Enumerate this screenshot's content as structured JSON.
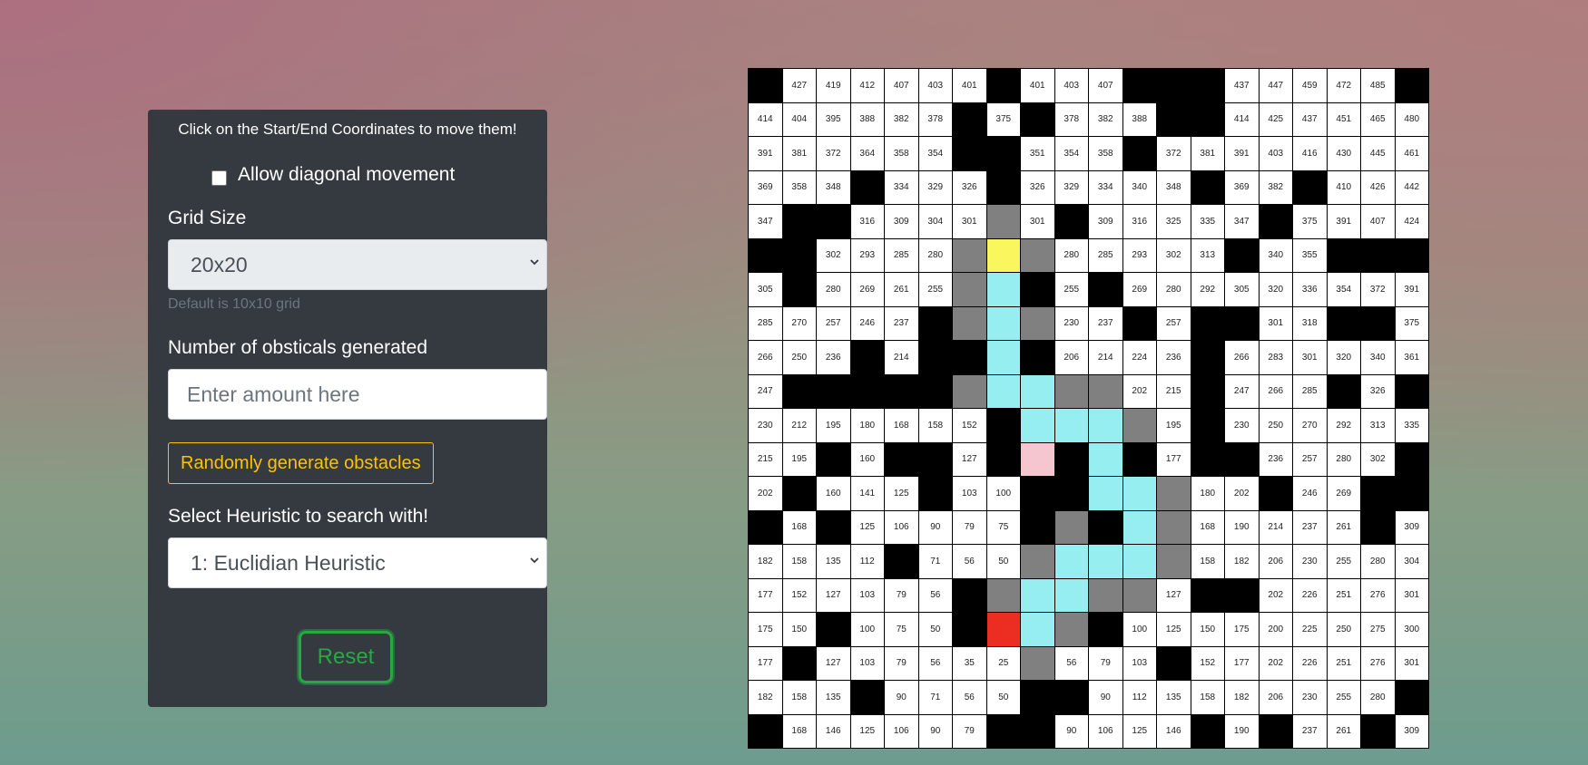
{
  "panel": {
    "hint": "Click on the Start/End Coordinates to move them!",
    "diagonal_label": "Allow diagonal movement",
    "grid_size_label": "Grid Size",
    "grid_size_value": "20x20",
    "grid_size_help": "Default is 10x10 grid",
    "obstacles_label": "Number of obsticals generated",
    "obstacles_placeholder": "Enter amount here",
    "generate_button": "Randomly generate obstacles",
    "heuristic_label": "Select Heuristic to search with!",
    "heuristic_value": "1: Euclidian Heuristic",
    "reset_button": "Reset"
  },
  "colors": {
    "wall": "#000000",
    "visited": "#808080",
    "path": "#97eef0",
    "start": "#f9f65e",
    "end": "#ec2d22",
    "current": "#f5c6d0"
  },
  "legend_codes": {
    "W": "wall",
    "V": "visited",
    "P": "path",
    "S": "start",
    "E": "end",
    "C": "current",
    "": "empty"
  },
  "grid": [
    [
      "W",
      "427",
      "419",
      "412",
      "407",
      "403",
      "401",
      "W",
      "401",
      "403",
      "407",
      "W",
      "W",
      "W",
      "437",
      "447",
      "459",
      "472",
      "485",
      "W"
    ],
    [
      "414",
      "404",
      "395",
      "388",
      "382",
      "378",
      "W",
      "375",
      "W",
      "378",
      "382",
      "388",
      "W",
      "W",
      "414",
      "425",
      "437",
      "451",
      "465",
      "480"
    ],
    [
      "391",
      "381",
      "372",
      "364",
      "358",
      "354",
      "W",
      "W",
      "351",
      "354",
      "358",
      "W",
      "372",
      "381",
      "391",
      "403",
      "416",
      "430",
      "445",
      "461"
    ],
    [
      "369",
      "358",
      "348",
      "W",
      "334",
      "329",
      "326",
      "W",
      "326",
      "329",
      "334",
      "340",
      "348",
      "W",
      "369",
      "382",
      "W",
      "410",
      "426",
      "442"
    ],
    [
      "347",
      "W",
      "W",
      "316",
      "309",
      "304",
      "301",
      "V",
      "301",
      "W",
      "309",
      "316",
      "325",
      "335",
      "347",
      "W",
      "375",
      "391",
      "407",
      "424"
    ],
    [
      "W",
      "W",
      "302",
      "293",
      "285",
      "280",
      "V",
      "S",
      "V",
      "280",
      "285",
      "293",
      "302",
      "313",
      "W",
      "340",
      "355",
      "W",
      "W",
      "W"
    ],
    [
      "305",
      "W",
      "280",
      "269",
      "261",
      "255",
      "V",
      "P",
      "W",
      "255",
      "W",
      "269",
      "280",
      "292",
      "305",
      "320",
      "336",
      "354",
      "372",
      "391"
    ],
    [
      "285",
      "270",
      "257",
      "246",
      "237",
      "W",
      "V",
      "P",
      "V",
      "230",
      "237",
      "W",
      "257",
      "W",
      "W",
      "301",
      "318",
      "W",
      "W",
      "375"
    ],
    [
      "266",
      "250",
      "236",
      "W",
      "214",
      "W",
      "W",
      "P",
      "W",
      "206",
      "214",
      "224",
      "236",
      "W",
      "266",
      "283",
      "301",
      "320",
      "340",
      "361"
    ],
    [
      "247",
      "W",
      "W",
      "W",
      "W",
      "W",
      "V",
      "P",
      "P",
      "V",
      "V",
      "202",
      "215",
      "W",
      "247",
      "266",
      "285",
      "W",
      "326",
      "W"
    ],
    [
      "230",
      "212",
      "195",
      "180",
      "168",
      "158",
      "152",
      "W",
      "P",
      "P",
      "P",
      "V",
      "195",
      "W",
      "230",
      "250",
      "270",
      "292",
      "313",
      "335"
    ],
    [
      "215",
      "195",
      "W",
      "160",
      "W",
      "W",
      "127",
      "W",
      "C",
      "W",
      "P",
      "W",
      "177",
      "W",
      "W",
      "236",
      "257",
      "280",
      "302",
      "W"
    ],
    [
      "202",
      "W",
      "160",
      "141",
      "125",
      "W",
      "103",
      "100",
      "W",
      "W",
      "P",
      "P",
      "V",
      "180",
      "202",
      "W",
      "246",
      "269",
      "W",
      "W"
    ],
    [
      "W",
      "168",
      "W",
      "125",
      "106",
      "90",
      "79",
      "75",
      "W",
      "V",
      "W",
      "P",
      "V",
      "168",
      "190",
      "214",
      "237",
      "261",
      "W",
      "309"
    ],
    [
      "182",
      "158",
      "135",
      "112",
      "W",
      "71",
      "56",
      "50",
      "V",
      "P",
      "P",
      "P",
      "V",
      "158",
      "182",
      "206",
      "230",
      "255",
      "280",
      "304"
    ],
    [
      "177",
      "152",
      "127",
      "103",
      "79",
      "56",
      "W",
      "V",
      "P",
      "P",
      "V",
      "V",
      "127",
      "W",
      "W",
      "202",
      "226",
      "251",
      "276",
      "301"
    ],
    [
      "175",
      "150",
      "W",
      "100",
      "75",
      "50",
      "W",
      "E",
      "P",
      "V",
      "W",
      "100",
      "125",
      "150",
      "175",
      "200",
      "225",
      "250",
      "275",
      "300"
    ],
    [
      "177",
      "W",
      "127",
      "103",
      "79",
      "56",
      "35",
      "25",
      "V",
      "56",
      "79",
      "103",
      "W",
      "152",
      "177",
      "202",
      "226",
      "251",
      "276",
      "301"
    ],
    [
      "182",
      "158",
      "135",
      "W",
      "90",
      "71",
      "56",
      "50",
      "W",
      "W",
      "90",
      "112",
      "135",
      "158",
      "182",
      "206",
      "230",
      "255",
      "280",
      "W"
    ],
    [
      "W",
      "168",
      "146",
      "125",
      "106",
      "90",
      "79",
      "W",
      "W",
      "90",
      "106",
      "125",
      "146",
      "W",
      "190",
      "W",
      "237",
      "261",
      "W",
      "309"
    ]
  ]
}
